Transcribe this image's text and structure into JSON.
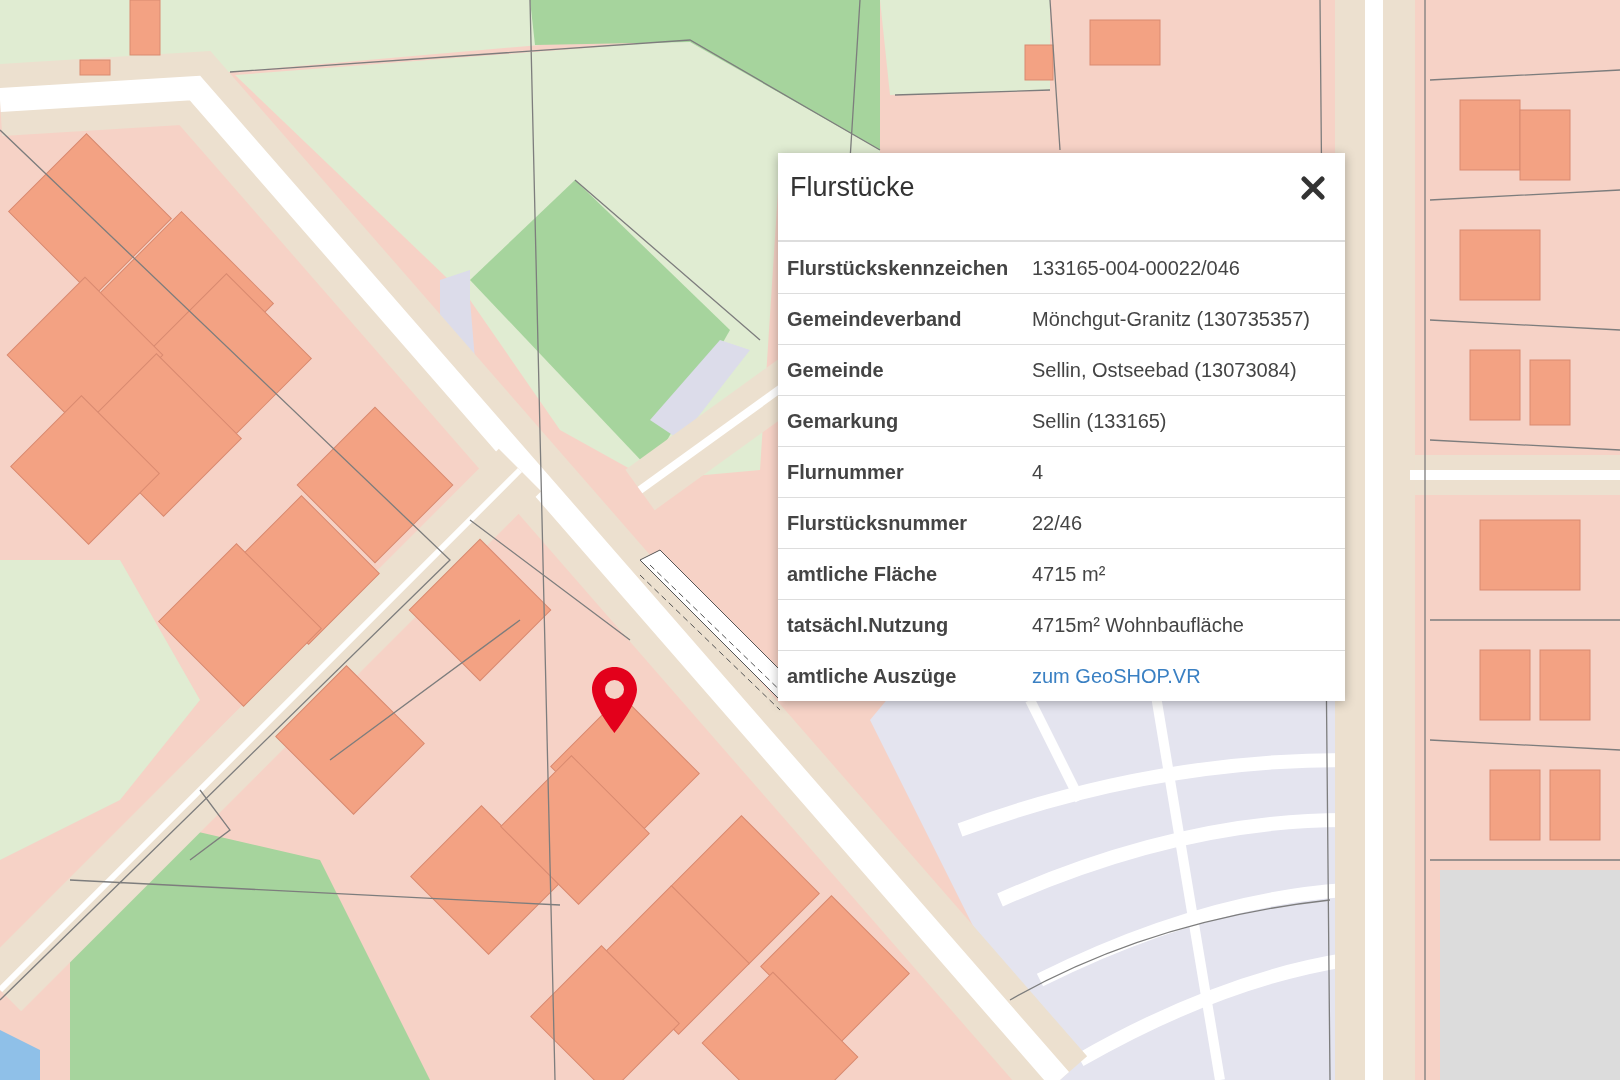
{
  "popup": {
    "title": "Flurstücke",
    "rows": [
      {
        "kind": "text",
        "label": "Flurstückskennzeichen",
        "value": "133165-004-00022/046"
      },
      {
        "kind": "text",
        "label": "Gemeindeverband",
        "value": "Mönchgut-Granitz (130735357)"
      },
      {
        "kind": "text",
        "label": "Gemeinde",
        "value": "Sellin, Ostseebad (13073084)"
      },
      {
        "kind": "text",
        "label": "Gemarkung",
        "value": "Sellin (133165)"
      },
      {
        "kind": "text",
        "label": "Flurnummer",
        "value": "4"
      },
      {
        "kind": "text",
        "label": "Flurstücksnummer",
        "value": "22/46"
      },
      {
        "kind": "text",
        "label": "amtliche Fläche",
        "value": "4715 m²"
      },
      {
        "kind": "text",
        "label": "tatsächl.Nutzung",
        "value": "4715m² Wohnbaufläche"
      },
      {
        "kind": "link",
        "label": "amtliche Auszüge",
        "value": "zum GeoSHOP.VR"
      }
    ]
  }
}
